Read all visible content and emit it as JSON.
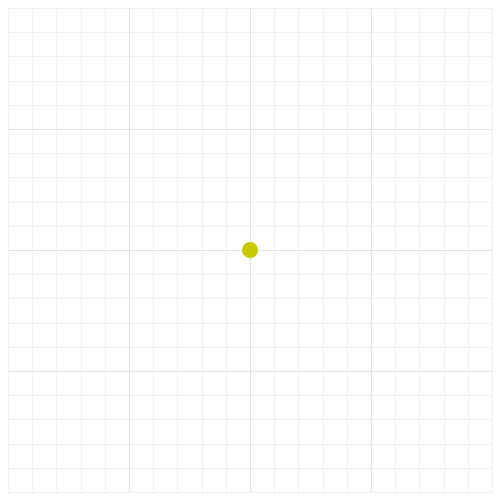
{
  "canvas": {
    "background_color": "#ffffff",
    "minor_grid_color": "#f0f0f0",
    "major_grid_color": "#e2e2e2",
    "minor_divisions": 20,
    "major_divisions": 4
  },
  "marker": {
    "color": "#c8c800",
    "position": "center",
    "shape": "circle"
  }
}
